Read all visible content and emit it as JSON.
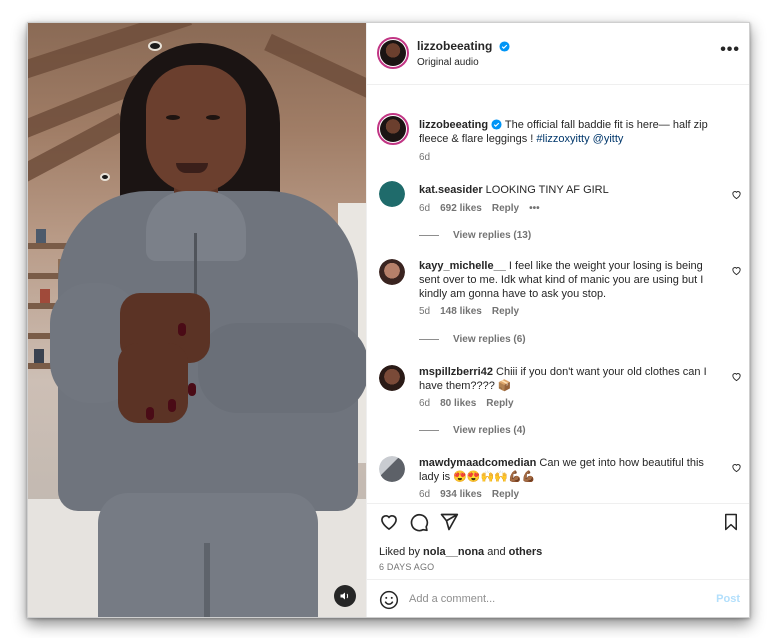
{
  "post": {
    "author": "lizzobeeating",
    "audio_label": "Original audio",
    "more_label": "•••"
  },
  "caption": {
    "username": "lizzobeeating",
    "text": " The official fall baddie fit is here— half zip fleece & flare leggings ! ",
    "hashtag": "#lizzoxyitty",
    "mention": "@yitty",
    "age": "6d"
  },
  "comments": [
    {
      "username": "kat.seasider",
      "text": " LOOKING TINY AF GIRL",
      "age": "6d",
      "likes": "692 likes",
      "reply": "Reply",
      "more": "•••",
      "view_replies": "View replies (13)",
      "avatar_color": "#1f6b6b"
    },
    {
      "username": "kayy_michelle__",
      "text": " I feel like the weight your losing is being sent over to me. Idk what kind of manic you are using but I kindly am gonna have to ask you stop.",
      "age": "5d",
      "likes": "148 likes",
      "reply": "Reply",
      "view_replies": "View replies (6)",
      "avatar_color": "#b6806a"
    },
    {
      "username": "mspillzberri42",
      "text": " Chiii if you don't want your old clothes can I have them???? 📦",
      "age": "6d",
      "likes": "80 likes",
      "reply": "Reply",
      "view_replies": "View replies (4)",
      "avatar_color": "#5a3a2e"
    },
    {
      "username": "mawdymaadcomedian",
      "text": " Can we get into how beautiful this lady is 😍😍🙌🙌💪🏾💪🏾",
      "age": "6d",
      "likes": "934 likes",
      "reply": "Reply",
      "avatar_color": "#8a8f96"
    }
  ],
  "engagement": {
    "liked_by_prefix": "Liked by ",
    "liked_by_user": "nola__nona",
    "liked_by_mid": " and ",
    "liked_by_others": "others",
    "time_ago": "6 DAYS AGO"
  },
  "composer": {
    "placeholder": "Add a comment...",
    "post_label": "Post"
  },
  "colors": {
    "verified": "#0095f6",
    "post_disabled": "#b2dffc",
    "avatar_ring": "#c13584"
  }
}
